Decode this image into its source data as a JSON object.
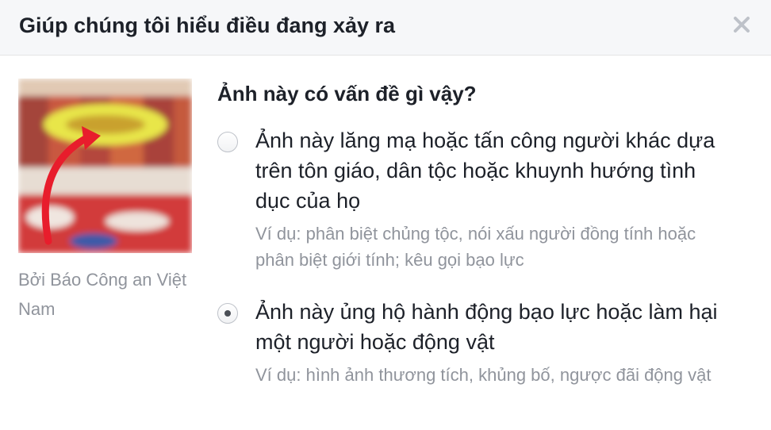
{
  "header": {
    "title": "Giúp chúng tôi hiểu điều đang xảy ra",
    "close_icon": "close-icon"
  },
  "post": {
    "attribution": "Bởi Báo Công an Việt Nam"
  },
  "form": {
    "question": "Ảnh này có vấn đề gì vậy?",
    "options": [
      {
        "label": "Ảnh này lăng mạ hoặc tấn công người khác dựa trên tôn giáo, dân tộc hoặc khuynh hướng tình dục của họ",
        "example": "Ví dụ: phân biệt chủng tộc, nói xấu người đồng tính hoặc phân biệt giới tính; kêu gọi bạo lực",
        "selected": false
      },
      {
        "label": "Ảnh này ủng hộ hành động bạo lực hoặc làm hại một người hoặc động vật",
        "example": "Ví dụ: hình ảnh thương tích, khủng bố, ngược đãi động vật",
        "selected": true
      }
    ]
  },
  "colors": {
    "header_bg": "#f6f7f9",
    "text": "#1d2129",
    "muted_text": "#90949c",
    "radio_dot": "#4b4f56"
  }
}
